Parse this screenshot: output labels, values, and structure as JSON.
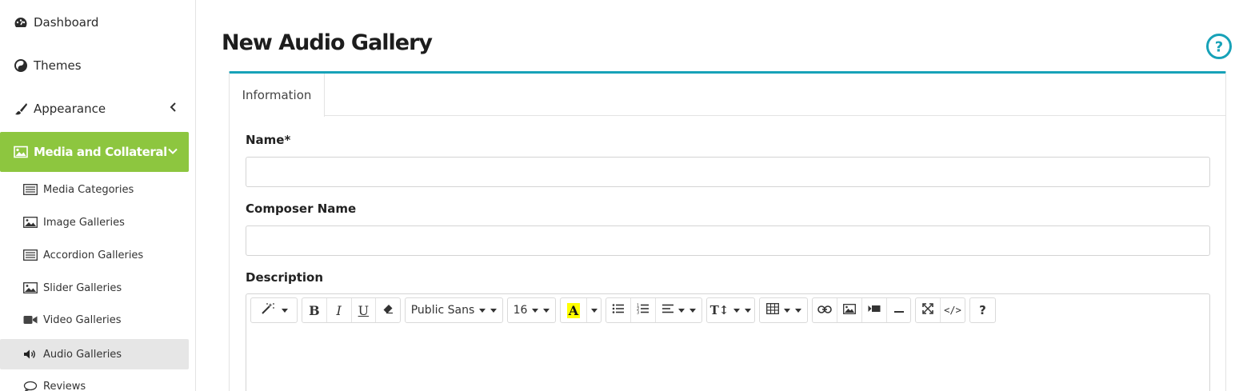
{
  "sidebar": {
    "items": [
      {
        "label": "Dashboard",
        "icon": "dashboard-icon"
      },
      {
        "label": "Themes",
        "icon": "themes-icon"
      },
      {
        "label": "Appearance",
        "icon": "brush-icon"
      },
      {
        "label": "Media and Collateral",
        "icon": "image-icon"
      }
    ],
    "sub_items": [
      {
        "label": "Media Categories",
        "icon": "list-icon"
      },
      {
        "label": "Image Galleries",
        "icon": "image-icon"
      },
      {
        "label": "Accordion Galleries",
        "icon": "list-icon"
      },
      {
        "label": "Slider Galleries",
        "icon": "image-icon"
      },
      {
        "label": "Video Galleries",
        "icon": "video-icon"
      },
      {
        "label": "Audio Galleries",
        "icon": "volume-icon"
      },
      {
        "label": "Reviews",
        "icon": "comment-icon"
      }
    ],
    "active_color": "#8dc63f"
  },
  "main": {
    "title": "New Audio Gallery",
    "accent_color": "#17a2b8",
    "tabs": [
      {
        "label": "Information"
      }
    ],
    "fields": {
      "name_label": "Name*",
      "name_value": "",
      "composer_label": "Composer Name",
      "composer_value": "",
      "description_label": "Description"
    },
    "editor": {
      "font_family": "Public Sans",
      "font_size": "16",
      "highlight_color": "#ffff00"
    }
  }
}
